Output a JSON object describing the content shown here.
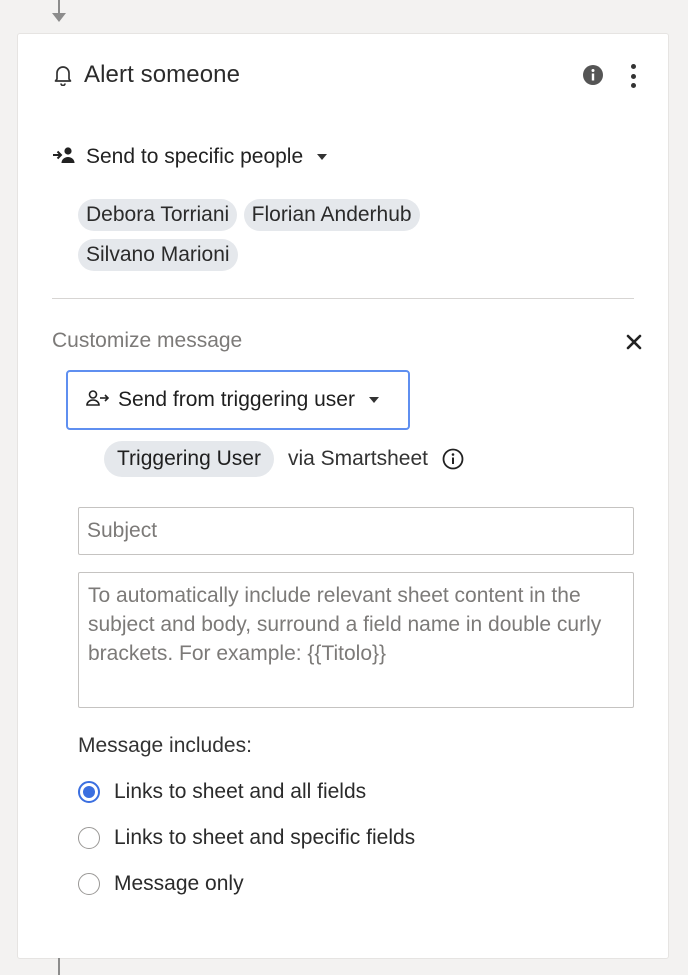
{
  "action": {
    "title": "Alert someone"
  },
  "recipients": {
    "mode_label": "Send to specific people",
    "people": [
      "Debora Torriani",
      "Florian Anderhub",
      "Silvano Marioni"
    ]
  },
  "customize": {
    "label": "Customize message",
    "from_label": "Send from triggering user",
    "sender_chip": "Triggering User",
    "via_text": "via Smartsheet",
    "subject_placeholder": "Subject",
    "body_placeholder": "To automatically include relevant sheet content in the subject and body, surround a field name in double curly brackets. For example: {{Titolo}}",
    "includes_label": "Message includes:",
    "options": [
      {
        "label": "Links to sheet and all fields",
        "checked": true
      },
      {
        "label": "Links to sheet and specific fields",
        "checked": false
      },
      {
        "label": "Message only",
        "checked": false
      }
    ]
  },
  "colors": {
    "accent": "#3b6fe0",
    "chip_bg": "#e5e8ec",
    "page_bg": "#f3f2f1"
  }
}
